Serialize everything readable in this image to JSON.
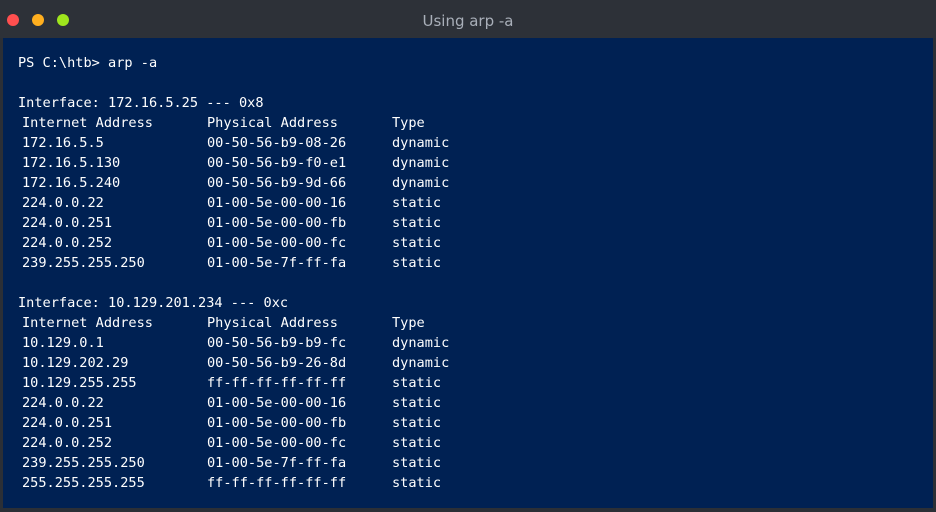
{
  "window": {
    "title": "Using arp -a"
  },
  "terminal": {
    "prompt": "PS C:\\htb> arp -a",
    "interfaces": [
      {
        "header": "Interface: 172.16.5.25 --- 0x8",
        "columns": [
          "Internet Address",
          "Physical Address",
          "Type"
        ],
        "rows": [
          [
            "172.16.5.5",
            "00-50-56-b9-08-26",
            "dynamic"
          ],
          [
            "172.16.5.130",
            "00-50-56-b9-f0-e1",
            "dynamic"
          ],
          [
            "172.16.5.240",
            "00-50-56-b9-9d-66",
            "dynamic"
          ],
          [
            "224.0.0.22",
            "01-00-5e-00-00-16",
            "static"
          ],
          [
            "224.0.0.251",
            "01-00-5e-00-00-fb",
            "static"
          ],
          [
            "224.0.0.252",
            "01-00-5e-00-00-fc",
            "static"
          ],
          [
            "239.255.255.250",
            "01-00-5e-7f-ff-fa",
            "static"
          ]
        ]
      },
      {
        "header": "Interface: 10.129.201.234 --- 0xc",
        "columns": [
          "Internet Address",
          "Physical Address",
          "Type"
        ],
        "rows": [
          [
            "10.129.0.1",
            "00-50-56-b9-b9-fc",
            "dynamic"
          ],
          [
            "10.129.202.29",
            "00-50-56-b9-26-8d",
            "dynamic"
          ],
          [
            "10.129.255.255",
            "ff-ff-ff-ff-ff-ff",
            "static"
          ],
          [
            "224.0.0.22",
            "01-00-5e-00-00-16",
            "static"
          ],
          [
            "224.0.0.251",
            "01-00-5e-00-00-fb",
            "static"
          ],
          [
            "224.0.0.252",
            "01-00-5e-00-00-fc",
            "static"
          ],
          [
            "239.255.255.250",
            "01-00-5e-7f-ff-fa",
            "static"
          ],
          [
            "255.255.255.255",
            "ff-ff-ff-ff-ff-ff",
            "static"
          ]
        ]
      }
    ]
  }
}
